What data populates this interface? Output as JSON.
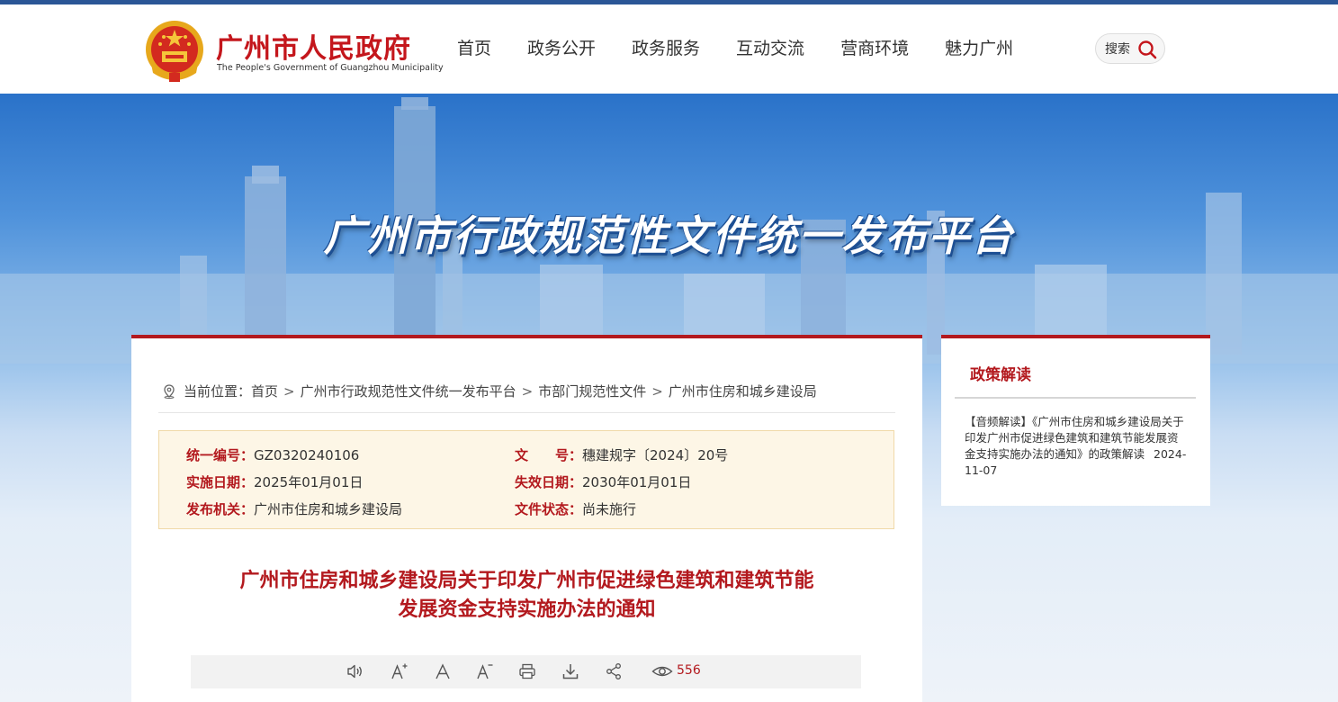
{
  "header": {
    "site_title": "广州市人民政府",
    "site_subtitle": "The People's Government of Guangzhou Municipality",
    "nav": [
      "首页",
      "政务公开",
      "政务服务",
      "互动交流",
      "营商环境",
      "魅力广州"
    ],
    "search_label": "搜索"
  },
  "banner": {
    "title": "广州市行政规范性文件统一发布平台"
  },
  "breadcrumb": {
    "prefix": "当前位置：",
    "items": [
      "首页",
      "广州市行政规范性文件统一发布平台",
      "市部门规范性文件",
      "广州市住房和城乡建设局"
    ],
    "separator": ">"
  },
  "meta": {
    "code_label": "统一编号：",
    "code_value": "GZ0320240106",
    "doc_no_label": "文　　号：",
    "doc_no_value": "穗建规字〔2024〕20号",
    "start_label": "实施日期：",
    "start_value": "2025年01月01日",
    "end_label": "失效日期：",
    "end_value": "2030年01月01日",
    "issuer_label": "发布机关：",
    "issuer_value": "广州市住房和城乡建设局",
    "status_label": "文件状态：",
    "status_value": "尚未施行"
  },
  "document": {
    "title_line1": "广州市住房和城乡建设局关于印发广州市促进绿色建筑和建筑节能",
    "title_line2": "发展资金支持实施办法的通知"
  },
  "toolbar": {
    "view_count": "556",
    "tools": [
      "audio-icon",
      "font-increase-icon",
      "font-reset-icon",
      "font-decrease-icon",
      "print-icon",
      "download-icon",
      "share-icon",
      "eye-icon"
    ]
  },
  "sidebar": {
    "title": "政策解读",
    "item_text": "【音频解读】《广州市住房和城乡建设局关于印发广州市促进绿色建筑和建筑节能发展资金支持实施办法的通知》的政策解读",
    "item_date": "2024-11-07"
  },
  "colors": {
    "brand_red": "#b3191e",
    "top_bar": "#2b5696",
    "meta_bg": "#fdf6e6"
  }
}
